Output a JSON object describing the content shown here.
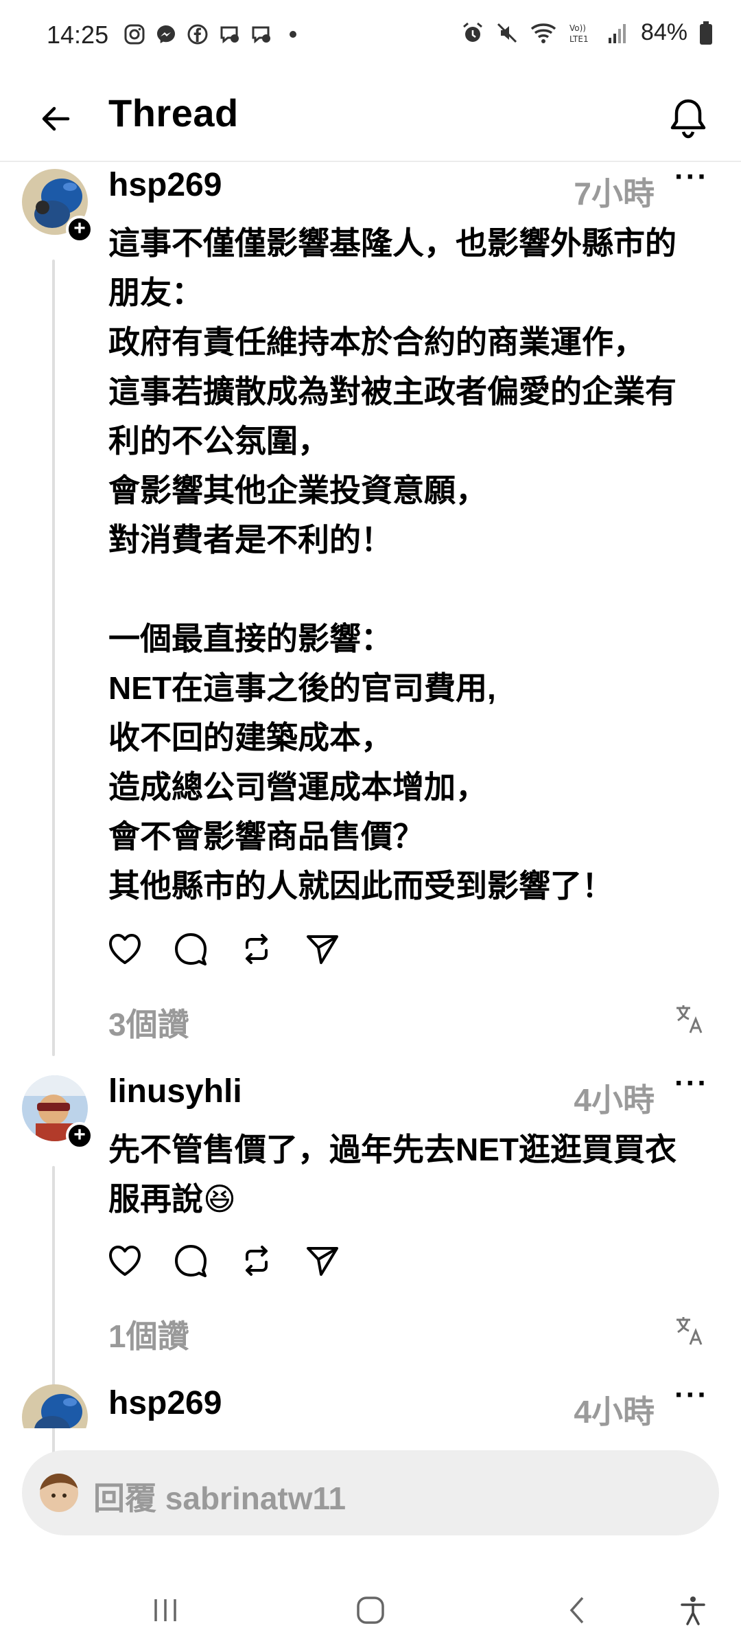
{
  "status_bar": {
    "time": "14:25",
    "battery": "84%",
    "left_icons": [
      "instagram-icon",
      "messenger-icon",
      "facebook-icon",
      "chat-bubble-icon",
      "chat-bubble-icon"
    ],
    "right_icons": [
      "alarm-icon",
      "mute-icon",
      "wifi-icon",
      "volte-icon",
      "signal-icon",
      "battery-icon"
    ]
  },
  "header": {
    "title": "Thread"
  },
  "posts": [
    {
      "username": "hsp269",
      "time": "7小時",
      "lines": [
        "這事不僅僅影響基隆人，也影響外縣市的",
        "朋友：",
        "政府有責任維持本於合約的商業運作，",
        "這事若擴散成為對被主政者偏愛的企業有",
        "利的不公氛圍，",
        "會影響其他企業投資意願，",
        "對消費者是不利的！",
        "",
        "一個最直接的影響：",
        "NET在這事之後的官司費用,",
        "收不回的建築成本，",
        "造成總公司營運成本增加，",
        "會不會影響商品售價？",
        "其他縣市的人就因此而受到影響了！"
      ],
      "likes": "3個讚"
    },
    {
      "username": "linusyhli",
      "time": "4小時",
      "lines": [
        "先不管售價了，過年先去NET逛逛買買衣",
        "服再說😆"
      ],
      "likes": "1個讚"
    },
    {
      "username": "hsp269",
      "time": "4小時"
    }
  ],
  "reply_bar": {
    "placeholder": "回覆 sabrinatw11"
  },
  "colors": {
    "text": "#000000",
    "muted": "#999999",
    "thread_line": "#dedede",
    "reply_bg": "#eeeeee"
  }
}
